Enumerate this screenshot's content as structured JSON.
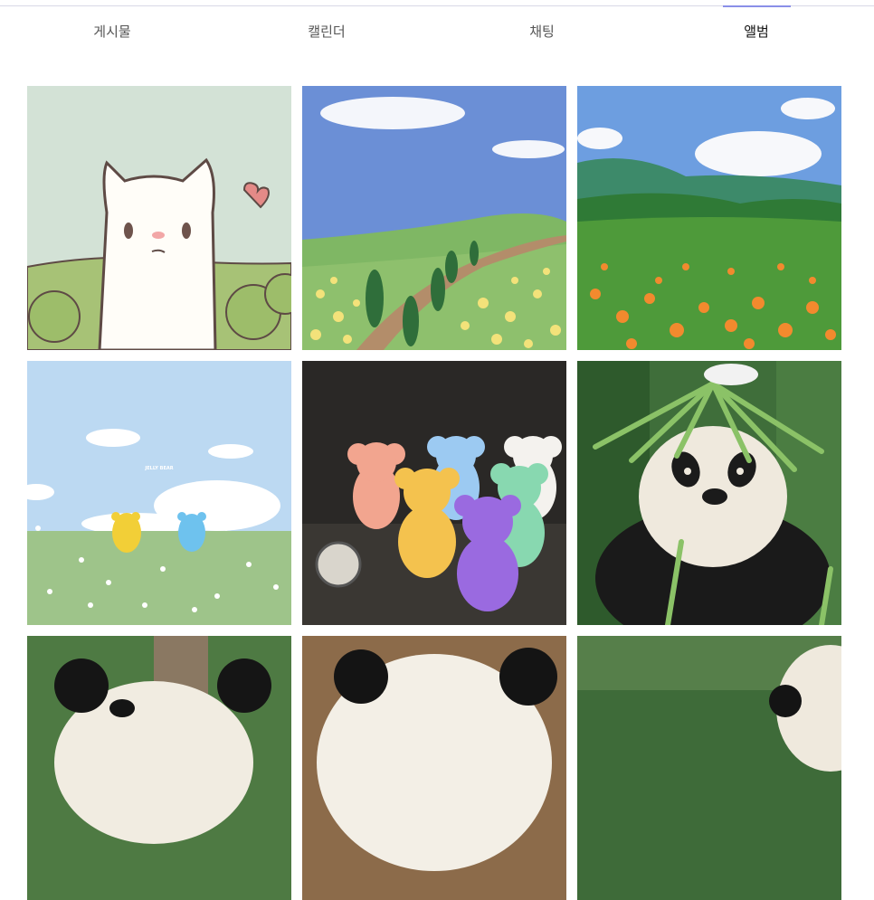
{
  "tabs": [
    {
      "label": "게시물",
      "active": false
    },
    {
      "label": "캘린더",
      "active": false
    },
    {
      "label": "채팅",
      "active": false
    },
    {
      "label": "앨범",
      "active": true
    }
  ],
  "album": {
    "photos": [
      {
        "subject": "white-cat-illustration"
      },
      {
        "subject": "flower-field-path-illustration"
      },
      {
        "subject": "green-hills-orange-flowers-illustration"
      },
      {
        "subject": "jelly-bear-meadow-illustration",
        "caption": "JELLY BEAR"
      },
      {
        "subject": "jelly-bear-lamps-photo"
      },
      {
        "subject": "panda-with-bamboo-photo"
      },
      {
        "subject": "panda-under-tree-photo"
      },
      {
        "subject": "panda-closeup-photo"
      },
      {
        "subject": "panda-in-forest-photo"
      }
    ]
  },
  "colors": {
    "accent": "#8a8fe8",
    "active_tab_text": "#111111",
    "tab_text": "#555555"
  }
}
